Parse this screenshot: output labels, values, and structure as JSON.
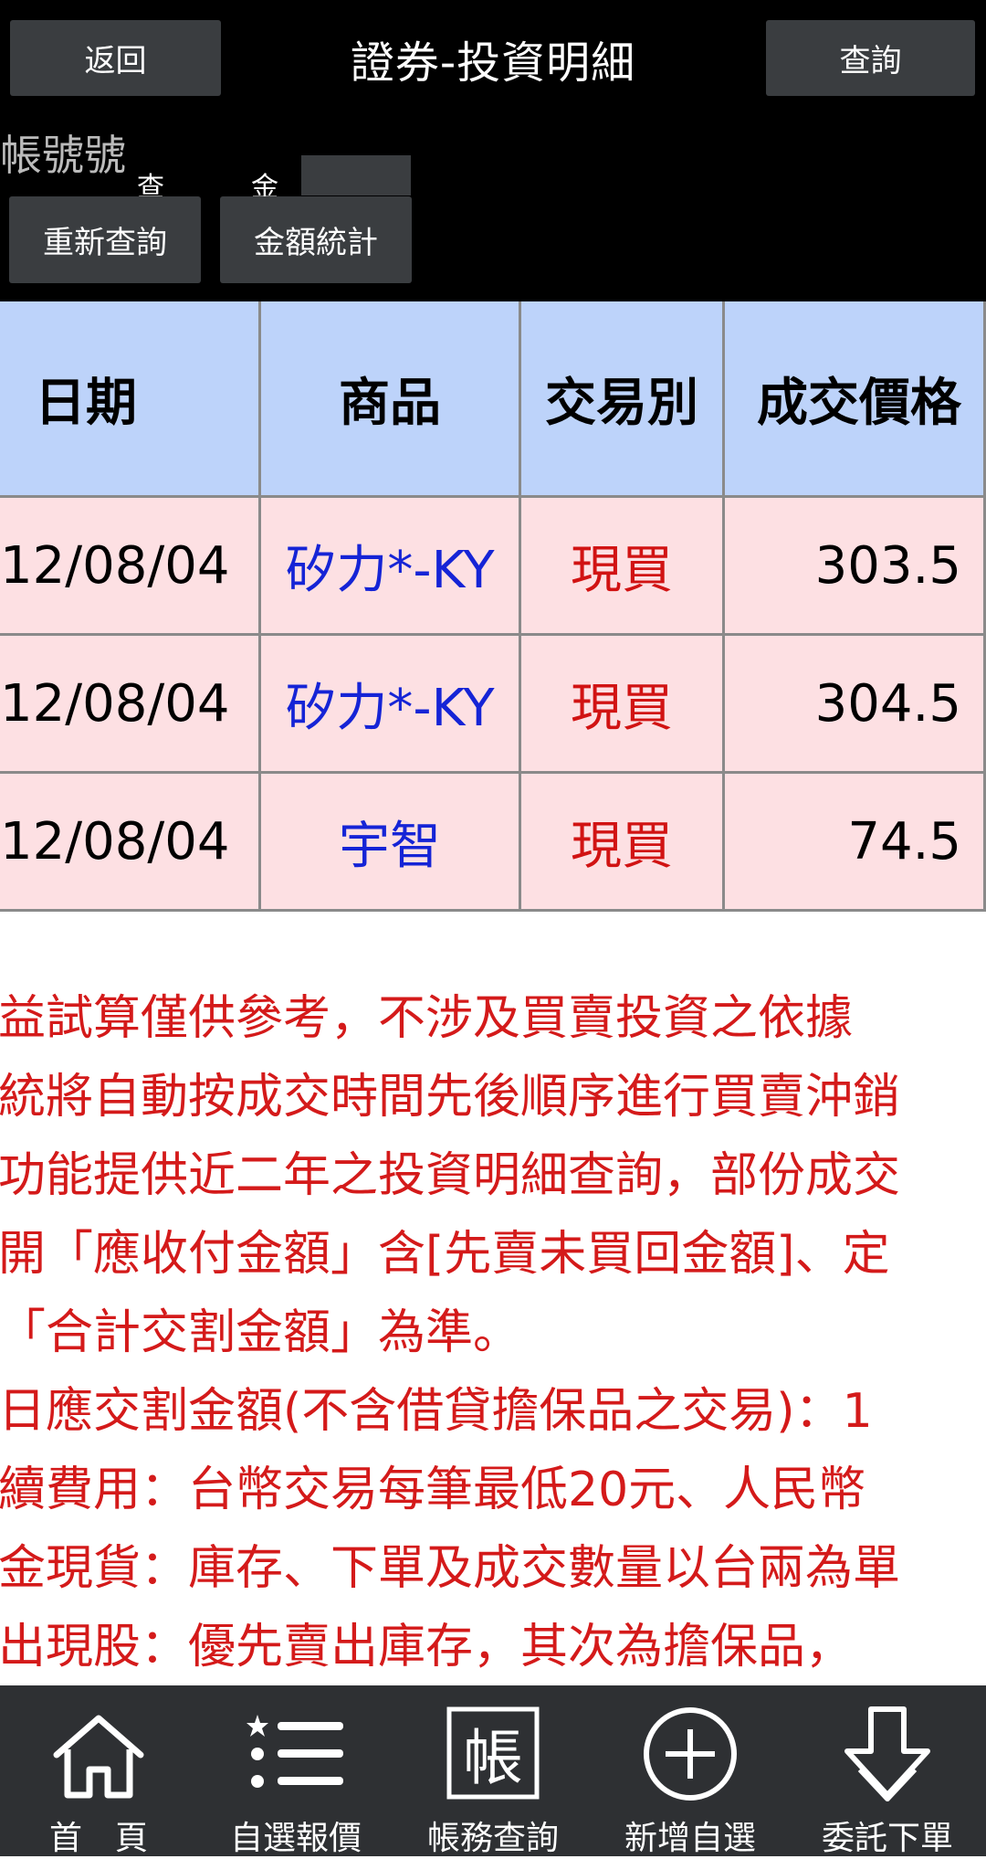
{
  "header": {
    "back_label": "返回",
    "title": "證券-投資明細",
    "query_label": "查詢",
    "account_label": "帳號號",
    "fragment_1": "查",
    "fragment_2": "金",
    "requery_label": "重新查詢",
    "sum_label": "金額統計"
  },
  "table": {
    "headers": [
      "日期",
      "商品",
      "交易別",
      "成交價格"
    ],
    "rows": [
      {
        "date": "12/08/04",
        "product": "矽力*-KY",
        "type": "現買",
        "price": "303.5"
      },
      {
        "date": "12/08/04",
        "product": "矽力*-KY",
        "type": "現買",
        "price": "304.5"
      },
      {
        "date": "12/08/04",
        "product": "宇智",
        "type": "現買",
        "price": "74.5"
      }
    ]
  },
  "notes": [
    "益試算僅供參考，不涉及買賣投資之依據",
    "統將自動按成交時間先後順序進行買賣沖銷",
    "功能提供近二年之投資明細查詢，部份成交",
    "開「應收付金額」含[先賣未買回金額]、定",
    "「合計交割金額」為準。",
    "日應交割金額(不含借貸擔保品之交易)：1",
    "續費用：台幣交易每筆最低20元、人民幣",
    "金現貨：庫存、下單及成交數量以台兩為單",
    "出現股：優先賣出庫存，其次為擔保品，"
  ],
  "bottom_nav": [
    {
      "label": "首　頁",
      "icon": "home-icon"
    },
    {
      "label": "自選報價",
      "icon": "watchlist-icon"
    },
    {
      "label": "帳務查詢",
      "icon": "account-book-icon"
    },
    {
      "label": "新增自選",
      "icon": "add-circle-icon"
    },
    {
      "label": "委託下單",
      "icon": "order-down-arrow-icon"
    }
  ],
  "colors": {
    "header_bg": "#000000",
    "button_bg": "#3a3d40",
    "table_header_bg": "#bdd3fa",
    "table_row_bg": "#fde0e3",
    "product_text": "#1524d6",
    "trade_type_text": "#d11313",
    "notes_text": "#d41a1a",
    "nav_bg": "#2e3033"
  }
}
